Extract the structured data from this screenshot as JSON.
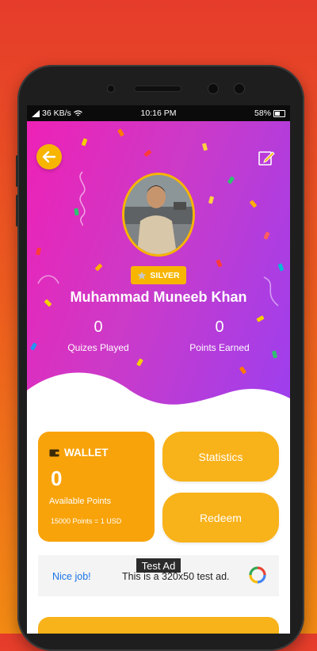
{
  "status_bar": {
    "network": "36 KB/s",
    "time": "10:16 PM",
    "battery": "58%"
  },
  "profile": {
    "rank_badge": "SILVER",
    "name": "Muhammad Muneeb Khan",
    "quizzes_played_value": "0",
    "quizzes_played_label": "Quizes Played",
    "points_earned_value": "0",
    "points_earned_label": "Points Earned"
  },
  "wallet": {
    "title": "WALLET",
    "points": "0",
    "available_label": "Available Points",
    "rate": "15000 Points = 1 USD"
  },
  "actions": {
    "statistics_label": "Statistics",
    "redeem_label": "Redeem"
  },
  "ad": {
    "label": "Test Ad",
    "nice_job": "Nice job!",
    "text": "This is a 320x50 test ad."
  },
  "colors": {
    "accent": "#f7b500",
    "header_left": "#ee21b6",
    "header_right": "#9b3ff0",
    "background_top": "#e53c2b",
    "background_bottom": "#f28a13"
  },
  "icons": [
    "back-arrow-icon",
    "edit-pencil-icon",
    "star-icon",
    "wallet-icon",
    "wifi-icon",
    "signal-icon",
    "battery-icon"
  ]
}
